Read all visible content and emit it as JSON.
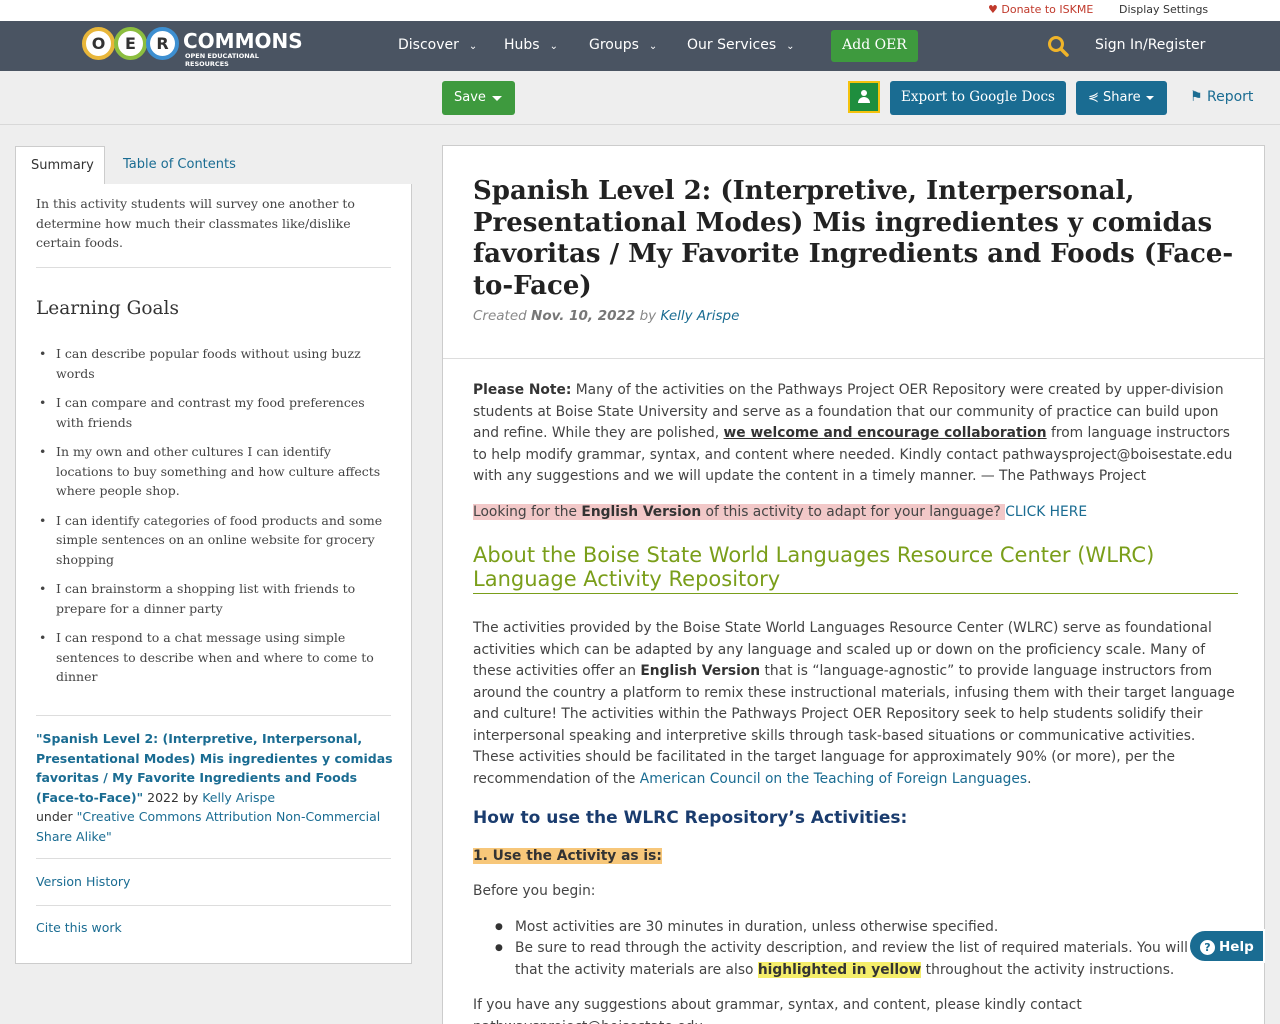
{
  "util": {
    "donate": "Donate to ISKME",
    "display_settings": "Display Settings"
  },
  "logo": {
    "letters": [
      "O",
      "E",
      "R"
    ],
    "word": "COMMONS",
    "sub": "OPEN EDUCATIONAL RESOURCES"
  },
  "nav": {
    "items": [
      "Discover",
      "Hubs",
      "Groups",
      "Our Services"
    ],
    "add_oer": "Add OER",
    "sign_in": "Sign In/Register"
  },
  "toolbar": {
    "save": "Save",
    "export": "Export to Google Docs",
    "share": "Share",
    "report": "Report"
  },
  "tabs": {
    "summary": "Summary",
    "toc": "Table of Contents"
  },
  "summary": {
    "text": "In this activity students will survey one another to determine how much their classmates like/dislike certain foods.",
    "goals_title": "Learning Goals",
    "goals": [
      "I can describe popular foods without using buzz words",
      "I can compare and contrast my food preferences with friends",
      "In my own and other cultures I can identify locations to buy something and how culture affects where people shop.",
      "I can identify categories of food products and some simple sentences on an online website for grocery shopping",
      "I can brainstorm a shopping list with friends to prepare for a dinner party",
      "I can respond to a chat message using simple sentences to describe when and where to come to dinner"
    ],
    "attr_title": "\"Spanish Level 2: (Interpretive, Interpersonal, Presentational Modes) Mis ingredientes y comidas favoritas / My Favorite Ingredients and Foods (Face-to-Face)\"",
    "attr_year": " 2022 by ",
    "attr_author": "Kelly Arispe",
    "attr_under": "under ",
    "attr_license": "\"Creative Commons Attribution Non-Commercial Share Alike\"",
    "version_history": "Version History",
    "cite": "Cite this work"
  },
  "main": {
    "title": "Spanish Level 2: (Interpretive, Interpersonal, Presentational Modes) Mis ingredientes y comidas favoritas / My Favorite Ingredients and Foods (Face-to-Face)",
    "created_label": "Created ",
    "created_date": "Nov. 10, 2022",
    "by_label": " by ",
    "author": "Kelly Arispe",
    "note_label": "Please Note:",
    "note_1": " Many of the activities on the Pathways Project OER Repository were created by upper-division students at Boise State University and serve as a foundation that our community of practice can build upon and refine. While they are polished, ",
    "note_collab": "we welcome and encourage collaboration",
    "note_2": " from language instructors to help modify grammar, syntax, and content where needed. Kindly contact pathwaysproject@boisestate.edu with any suggestions and we will update the content in a timely manner.  — The Pathways Project",
    "english_1": "Looking for the ",
    "english_bold": "English Version",
    "english_2": " of this activity to adapt for your language? ",
    "click_here": "CLICK HERE",
    "about_heading": "About the Boise State World Languages Resource Center (WLRC) Language Activity Repository",
    "about_1": "The activities provided by the Boise State World Languages Resource Center (WLRC) serve as foundational activities which can be adapted by any language and scaled up or down on the proficiency scale. Many of these activities offer an ",
    "about_bold": "English Version",
    "about_2": " that is “language-agnostic” to provide language instructors from around the country a platform to remix these instructional materials, infusing them with their target language and culture! The activities within the Pathways Project OER Repository seek to help students solidify their interpersonal speaking and interpretive skills through task-based situations or communicative activities. These activities should be facilitated in the target language for approximately 90% (or more), per the recommendation of the ",
    "actfl": "American Council on the Teaching of Foreign Languages",
    "about_3": ".",
    "howto_heading": "How to use the WLRC Repository’s Activities:",
    "step1": "1. Use the Activity as is:",
    "before": "Before you begin:",
    "bullet1": "Most activities are 30 minutes in duration, unless otherwise specified.",
    "bullet2_a": "Be sure to read through the activity description, and review the list of required materials. You will notice that the activity materials are also ",
    "bullet2_hl": "highlighted in yellow",
    "bullet2_b": " throughout the activity instructions.",
    "suggest": "If you have any suggestions about grammar, syntax, and content, please kindly contact pathwaysproject@boisestate.edu"
  },
  "help": "Help"
}
